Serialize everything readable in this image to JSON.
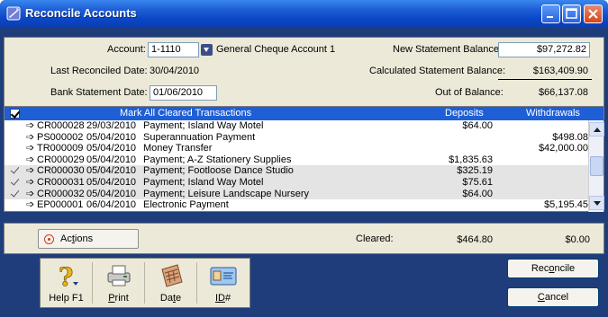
{
  "window": {
    "title": "Reconcile Accounts"
  },
  "header": {
    "account_label": "Account:",
    "account_value": "1-1110",
    "account_name": "General Cheque Account 1",
    "last_reconciled_label": "Last Reconciled Date:",
    "last_reconciled_value": "30/04/2010",
    "bank_statement_date_label": "Bank Statement Date:",
    "bank_statement_date_value": "01/06/2010",
    "new_statement_balance_label": "New Statement Balance:",
    "new_statement_balance_value": "$97,272.82",
    "calculated_balance_label": "Calculated Statement Balance:",
    "calculated_balance_value": "$163,409.90",
    "out_of_balance_label": "Out of Balance:",
    "out_of_balance_value": "$66,137.08"
  },
  "list": {
    "header_mark_all": "Mark All Cleared Transactions",
    "header_deposits": "Deposits",
    "header_withdrawals": "Withdrawals",
    "rows": [
      {
        "cleared": false,
        "id": "CR000028",
        "date": "29/03/2010",
        "memo": "Payment; Island Way Motel",
        "deposit": "$64.00",
        "withdrawal": ""
      },
      {
        "cleared": false,
        "id": "PS000002",
        "date": "05/04/2010",
        "memo": "Superannuation Payment",
        "deposit": "",
        "withdrawal": "$498.08"
      },
      {
        "cleared": false,
        "id": "TR000009",
        "date": "05/04/2010",
        "memo": "Money Transfer",
        "deposit": "",
        "withdrawal": "$42,000.00"
      },
      {
        "cleared": false,
        "id": "CR000029",
        "date": "05/04/2010",
        "memo": "Payment; A-Z Stationery Supplies",
        "deposit": "$1,835.63",
        "withdrawal": ""
      },
      {
        "cleared": true,
        "id": "CR000030",
        "date": "05/04/2010",
        "memo": "Payment; Footloose Dance Studio",
        "deposit": "$325.19",
        "withdrawal": ""
      },
      {
        "cleared": true,
        "id": "CR000031",
        "date": "05/04/2010",
        "memo": "Payment; Island Way Motel",
        "deposit": "$75.61",
        "withdrawal": ""
      },
      {
        "cleared": true,
        "id": "CR000032",
        "date": "05/04/2010",
        "memo": "Payment; Leisure Landscape Nursery",
        "deposit": "$64.00",
        "withdrawal": ""
      },
      {
        "cleared": false,
        "id": "EP000001",
        "date": "06/04/2010",
        "memo": "Electronic Payment",
        "deposit": "",
        "withdrawal": "$5,195.45"
      }
    ]
  },
  "footer": {
    "actions_label_pre": "Ac",
    "actions_label_u": "t",
    "actions_label_post": "ions",
    "cleared_label": "Cleared:",
    "cleared_deposits": "$464.80",
    "cleared_withdrawals": "$0.00"
  },
  "toolbar": {
    "help": "Help F1",
    "print_u": "P",
    "print_rest": "rint",
    "date_pre": "Da",
    "date_u": "t",
    "date_post": "e",
    "id_u": "ID",
    "id_rest": "#"
  },
  "buttons": {
    "reconcile_pre": "Rec",
    "reconcile_u": "o",
    "reconcile_post": "ncile",
    "cancel_u": "C",
    "cancel_post": "ancel"
  },
  "colors": {
    "title_bar": "#0a47c8",
    "list_header": "#1f5fd6",
    "panel": "#ece9d8",
    "frame": "#1f3d7a"
  }
}
